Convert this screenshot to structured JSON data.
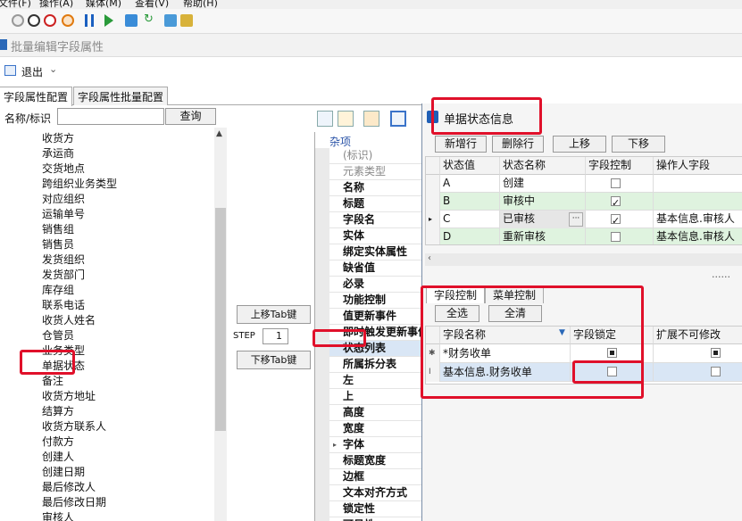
{
  "menubar": {
    "items": [
      "文件(F)",
      "操作(A)",
      "媒体(M)",
      "查看(V)",
      "帮助(H)"
    ]
  },
  "window": {
    "title": "批量编辑字段属性"
  },
  "exitbar": {
    "exit_label": "退出"
  },
  "tabs": [
    "字段属性配置",
    "字段属性批量配置"
  ],
  "search": {
    "label": "名称/标识",
    "value": "",
    "button": "查询"
  },
  "field_list": {
    "items": [
      "收货方",
      "承运商",
      "交货地点",
      "跨组织业务类型",
      "对应组织",
      "运输单号",
      "销售组",
      "销售员",
      "发货组织",
      "发货部门",
      "库存组",
      "联系电话",
      "收货人姓名",
      "仓管员",
      "业务类型",
      "单据状态",
      "备注",
      "收货方地址",
      "结算方",
      "收货方联系人",
      "付款方",
      "创建人",
      "创建日期",
      "最后修改人",
      "最后修改日期",
      "审核人"
    ]
  },
  "middle": {
    "up_button": "上移Tab键",
    "step_label": "STEP",
    "step_value": "1",
    "down_button": "下移Tab键"
  },
  "properties": {
    "category": "杂项",
    "rows": [
      "(标识)",
      "元素类型",
      "名称",
      "标题",
      "字段名",
      "实体",
      "绑定实体属性",
      "缺省值",
      "必录",
      "功能控制",
      "值更新事件",
      "即时触发更新事件",
      "状态列表",
      "所属拆分表",
      "左",
      "上",
      "高度",
      "宽度",
      "字体",
      "标题宽度",
      "边框",
      "文本对齐方式",
      "锁定性",
      "可见性"
    ]
  },
  "dialog": {
    "title": "单据状态信息",
    "buttons": {
      "add_row": "新增行",
      "delete_row": "删除行",
      "move_up": "上移",
      "move_down": "下移"
    },
    "grid1": {
      "headers": [
        "状态值",
        "状态名称",
        "字段控制",
        "操作人字段"
      ],
      "rows": [
        {
          "value": "A",
          "name": "创建",
          "control": false,
          "operator": ""
        },
        {
          "value": "B",
          "name": "审核中",
          "control": true,
          "operator": ""
        },
        {
          "value": "C",
          "name": "已审核",
          "control": true,
          "operator": "基本信息.审核人"
        },
        {
          "value": "D",
          "name": "重新审核",
          "control": false,
          "operator": "基本信息.审核人"
        }
      ]
    },
    "dots": "......",
    "subtabs": [
      "字段控制",
      "菜单控制"
    ],
    "select_all": "全选",
    "clear_all": "全清",
    "grid2": {
      "headers": [
        "字段名称",
        "字段锁定",
        "扩展不可修改"
      ],
      "rows": [
        {
          "name": "*财务收单",
          "locked": true,
          "ext": true
        },
        {
          "name": "基本信息.财务收单",
          "locked": false,
          "ext": false
        }
      ]
    }
  },
  "colors": {
    "highlight_red": "#e0102a",
    "green_row": "#dff3df",
    "selection_blue": "#d9e6f5"
  }
}
